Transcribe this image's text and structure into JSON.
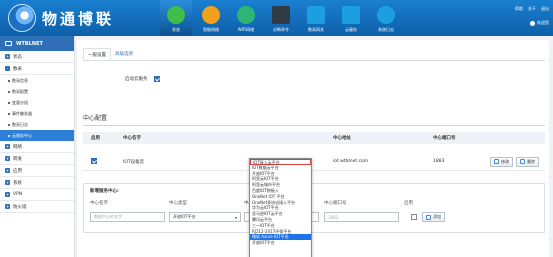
{
  "brand": {
    "title": "物通博联"
  },
  "nav": [
    {
      "label": "状态",
      "icon": "home-icon",
      "color": "#3fbf4a"
    },
    {
      "label": "智能网络",
      "icon": "network-icon",
      "color": "#f2a11b"
    },
    {
      "label": "WIFI网络",
      "icon": "wifi-icon",
      "color": "#2bb673"
    },
    {
      "label": "诊断命令",
      "icon": "terminal-icon",
      "color": "#303a44"
    },
    {
      "label": "数采网关",
      "icon": "gateway-icon",
      "color": "#1b9fe0"
    },
    {
      "label": "云服务",
      "icon": "cloud-icon",
      "color": "#1b9fe0"
    },
    {
      "label": "系统日志",
      "icon": "log-icon",
      "color": "#1b9fe0"
    }
  ],
  "top_links": {
    "help": "帮助",
    "about": "关于",
    "logout": "退出"
  },
  "user": {
    "name": "欢迎您"
  },
  "sidebar": {
    "title": "WTBLNET",
    "groups": [
      {
        "label": "状态"
      },
      {
        "label": "数采"
      }
    ],
    "subitems": [
      {
        "label": "数采信息"
      },
      {
        "label": "数采配置"
      },
      {
        "label": "变量分组"
      },
      {
        "label": "事件触发器"
      },
      {
        "label": "数采日志"
      },
      {
        "label": "云服务中心"
      }
    ],
    "groups2": [
      {
        "label": "网络"
      },
      {
        "label": "转发"
      },
      {
        "label": "应用"
      },
      {
        "label": "系统"
      },
      {
        "label": "VPN"
      },
      {
        "label": "防火墙"
      }
    ]
  },
  "tabs": [
    {
      "label": "一般设置"
    },
    {
      "label": "高级选项"
    }
  ],
  "enable_cloud": {
    "label": "启动云服务"
  },
  "center": {
    "title": "中心配置",
    "headers": {
      "enable": "启用",
      "name": "中心名字",
      "addr": "中心地址",
      "port": "中心端口号"
    },
    "row": {
      "name": "IOT设备云",
      "addr": "iot.wtblnet.com",
      "port": "1883"
    },
    "edit_label": "修改",
    "delete_label": "删除"
  },
  "add": {
    "title": "新增服务中心:",
    "headers": {
      "name": "中心名字",
      "type": "中心类型",
      "addr": "中心地址",
      "port": "中心端口号",
      "enable": "启用"
    },
    "name_placeholder": "数据中心的名字",
    "type_value": "开放IOT平台",
    "port_placeholder": "1883",
    "add_label": "添加"
  },
  "dropdown_options": [
    "IOT接入云平台",
    "IOT数据云平台",
    "开放IOT平台",
    "阿里云IOT平台",
    "阿里云城市平台",
    "百度IOT物接入",
    "OneNet IOT 平台",
    "OneNet多协议接入平台",
    "华为云IOT平台",
    "亚马逊IOT云平台",
    "腾讯云平台",
    "三一IOT平台",
    "RJ212-2017环保平台",
    "微软 Azure IOT平台",
    "开放IOT平台"
  ]
}
